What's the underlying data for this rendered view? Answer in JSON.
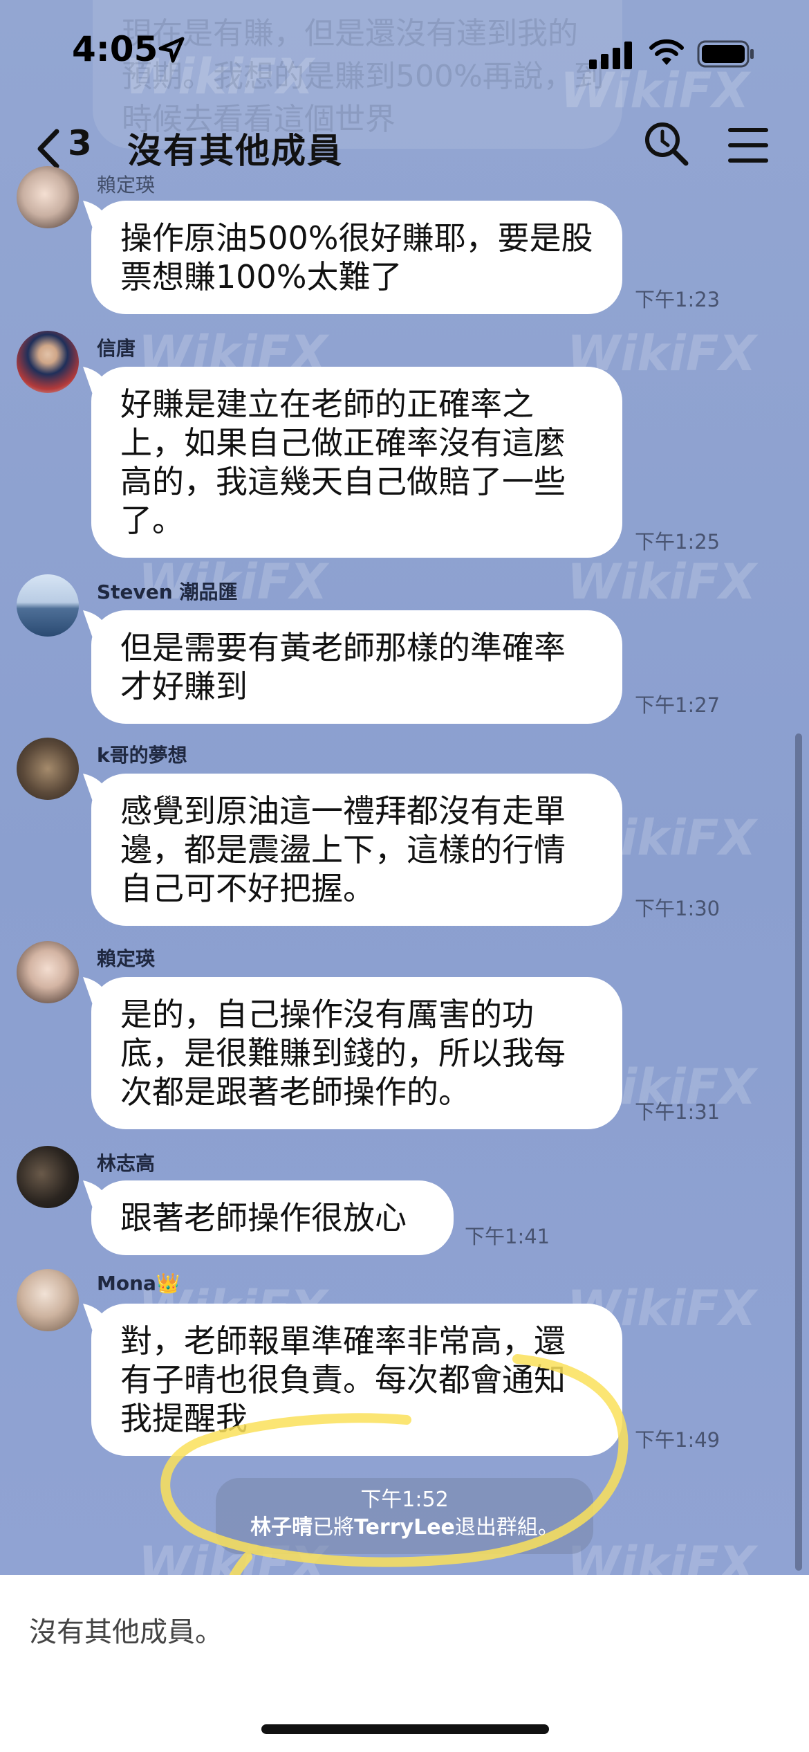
{
  "status_bar": {
    "time": "4:05"
  },
  "nav": {
    "unread_count": "3",
    "title": "沒有其他成員"
  },
  "header_ghost_message": "現在是有賺，但是還沒有達到我的預期。我想的是賺到500%再說，到時候去看看這個世界",
  "cut_sender_name": "賴定瑛",
  "messages": [
    {
      "sender": "",
      "text": "操作原油500%很好賺耶，要是股票想賺100%太難了",
      "time": "下午1:23"
    },
    {
      "sender": "信唐",
      "text": "好賺是建立在老師的正確率之上，如果自己做正確率沒有這麼高的，我這幾天自己做賠了一些了。",
      "time": "下午1:25"
    },
    {
      "sender": "Steven 潮品匯",
      "text": "但是需要有黃老師那樣的準確率才好賺到",
      "time": "下午1:27"
    },
    {
      "sender": "k哥的夢想",
      "text": "感覺到原油這一禮拜都沒有走單邊，都是震盪上下，這樣的行情自己可不好把握。",
      "time": "下午1:30"
    },
    {
      "sender": "賴定瑛",
      "text": "是的，自己操作沒有厲害的功底，是很難賺到錢的，所以我每次都是跟著老師操作的。",
      "time": "下午1:31"
    },
    {
      "sender": "林志高",
      "text": "跟著老師操作很放心",
      "time": "下午1:41"
    },
    {
      "sender": "Mona👑",
      "text": "對，老師報單準確率非常高，還有子晴也很負責。每次都會通知我提醒我",
      "time": "下午1:49"
    }
  ],
  "system_notice": {
    "time": "下午1:52",
    "actor": "林子晴",
    "middle": "已將",
    "target": "TerryLee",
    "suffix": "退出群組。"
  },
  "input": {
    "text": "沒有其他成員。"
  },
  "watermark": "WikiFX"
}
